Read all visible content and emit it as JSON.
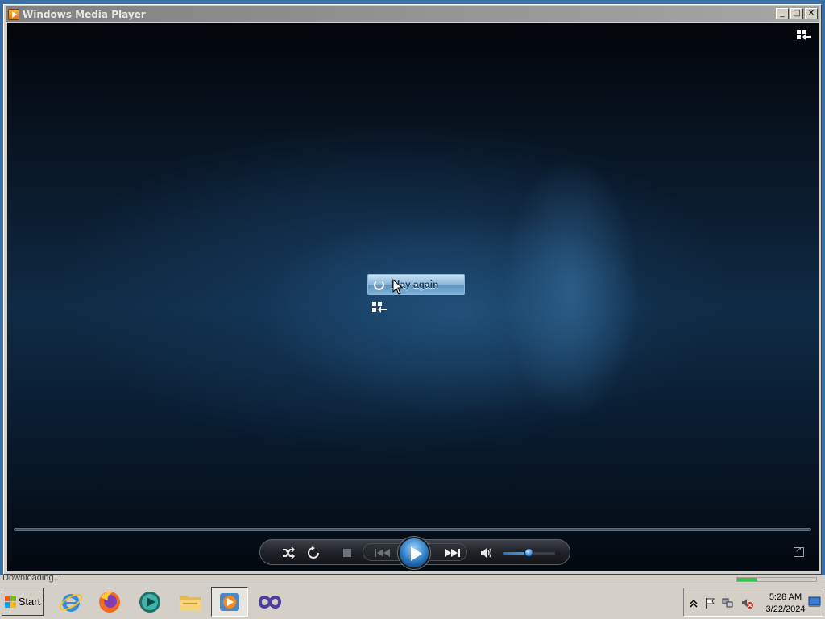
{
  "window": {
    "title": "Windows Media Player",
    "minimize_label": "_",
    "maximize_label": "□",
    "close_label": "✕"
  },
  "player": {
    "play_again_label": "Play again",
    "state": "stopped",
    "volume_level_pct": 52
  },
  "status": {
    "text": "Downloading...",
    "progress_pct": 25
  },
  "taskbar": {
    "start_label": "Start",
    "apps": [
      {
        "name": "internet-explorer-icon"
      },
      {
        "name": "firefox-icon"
      },
      {
        "name": "media-icon"
      },
      {
        "name": "file-explorer-icon"
      },
      {
        "name": "windows-media-player-icon",
        "active": true
      },
      {
        "name": "visual-studio-icon"
      }
    ],
    "tray_icons": [
      "show-hidden-icons-icon",
      "action-center-flag-icon",
      "network-icon",
      "volume-muted-icon"
    ],
    "clock": {
      "time": "5:28 AM",
      "date": "3/22/2024"
    }
  },
  "colors": {
    "accent": "#3d8ad0",
    "video_bg": "#0f2b45",
    "progress": "#35c24a"
  }
}
